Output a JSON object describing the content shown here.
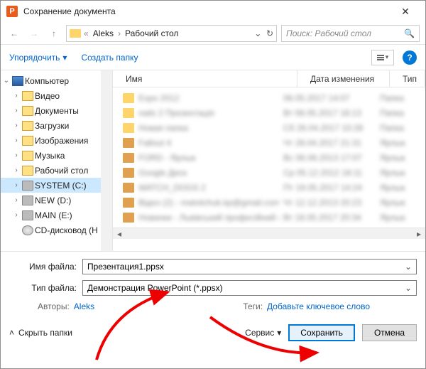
{
  "window": {
    "title": "Сохранение документа"
  },
  "breadcrumbs": {
    "sep": "«",
    "part1": "Aleks",
    "part2": "Рабочий стол",
    "chev": "›"
  },
  "search": {
    "placeholder": "Поиск: Рабочий стол"
  },
  "toolbar": {
    "organize": "Упорядочить",
    "newfolder": "Создать папку"
  },
  "tree": {
    "computer": "Компьютер",
    "video": "Видео",
    "documents": "Документы",
    "downloads": "Загрузки",
    "images": "Изображения",
    "music": "Музыка",
    "desktop": "Рабочий стол",
    "system": "SYSTEM (C:)",
    "new": "NEW (D:)",
    "main": "MAIN (E:)",
    "cd": "CD-дисковод (H"
  },
  "columns": {
    "name": "Имя",
    "date": "Дата изменения",
    "type": "Тип"
  },
  "files": [
    {
      "name": "Expo 2012",
      "date": "06.05.2017 14:07",
      "type": "Папка",
      "icon": "folder"
    },
    {
      "name": "nails 2 Презентація",
      "date": "Вт 08.05.2017 18:13",
      "type": "Папка",
      "icon": "folder"
    },
    {
      "name": "Новая папка",
      "date": "Сб 26.04.2017 10:28",
      "type": "Папка",
      "icon": "folder"
    },
    {
      "name": "Fallout 4",
      "date": "Чт 28.04.2017 21:31",
      "type": "Ярлык",
      "icon": "file"
    },
    {
      "name": "FORD - Ярлык",
      "date": "Вс 06.06.2013 17:07",
      "type": "Ярлык",
      "icon": "file"
    },
    {
      "name": "Google Диск",
      "date": "Ср 05.12.2012 18:11",
      "type": "Ярлык",
      "icon": "file"
    },
    {
      "name": "WATCH_DOGS 2",
      "date": "Пт 19.05.2017 14:24",
      "type": "Ярлык",
      "icon": "file"
    },
    {
      "name": "Відео (2) - matviichuk.kp@gmail.com - G…",
      "date": "Чт 12.12.2013 20:23",
      "type": "Ярлык",
      "icon": "file"
    },
    {
      "name": "Новинки - Львівський професійний кол…",
      "date": "Вт 18.05.2017 20:34",
      "type": "Ярлык",
      "icon": "file"
    }
  ],
  "fields": {
    "filename_label": "Имя файла:",
    "filename_value": "Презентация1.ppsx",
    "filetype_label": "Тип файла:",
    "filetype_value": "Демонстрация PowerPoint (*.ppsx)",
    "authors_label": "Авторы:",
    "authors_value": "Aleks",
    "tags_label": "Теги:",
    "tags_value": "Добавьте ключевое слово"
  },
  "footer": {
    "hide": "Скрыть папки",
    "service": "Сервис",
    "save": "Сохранить",
    "cancel": "Отмена"
  }
}
